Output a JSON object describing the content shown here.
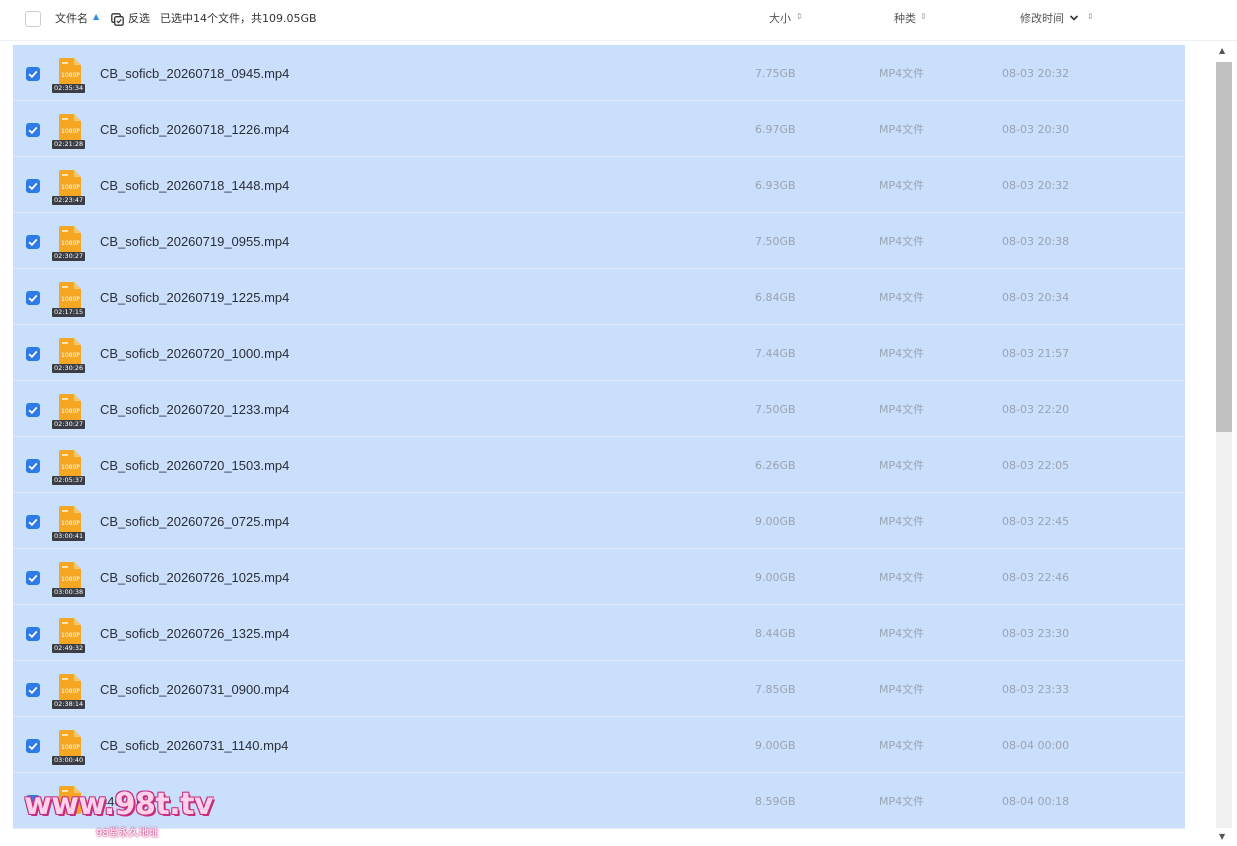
{
  "header": {
    "name_label": "文件名",
    "invert_label": "反选",
    "selection_summary": "已选中14个文件，共109.05GB",
    "size_label": "大小",
    "type_label": "种类",
    "time_label": "修改时间"
  },
  "colors": {
    "row_selected_bg": "#cadffc",
    "checkbox_checked": "#2e7be6",
    "file_icon": "#f5a623",
    "sort_active": "#2d8cf0"
  },
  "files": [
    {
      "name": "CB_soficb_20260718_0945.mp4",
      "size": "7.75GB",
      "type": "MP4文件",
      "modified": "08-03 20:32",
      "resolution": "1080P",
      "duration": "02:35:34",
      "checked": true
    },
    {
      "name": "CB_soficb_20260718_1226.mp4",
      "size": "6.97GB",
      "type": "MP4文件",
      "modified": "08-03 20:30",
      "resolution": "1080P",
      "duration": "02:21:28",
      "checked": true
    },
    {
      "name": "CB_soficb_20260718_1448.mp4",
      "size": "6.93GB",
      "type": "MP4文件",
      "modified": "08-03 20:32",
      "resolution": "1080P",
      "duration": "02:23:47",
      "checked": true
    },
    {
      "name": "CB_soficb_20260719_0955.mp4",
      "size": "7.50GB",
      "type": "MP4文件",
      "modified": "08-03 20:38",
      "resolution": "1080P",
      "duration": "02:30:27",
      "checked": true
    },
    {
      "name": "CB_soficb_20260719_1225.mp4",
      "size": "6.84GB",
      "type": "MP4文件",
      "modified": "08-03 20:34",
      "resolution": "1080P",
      "duration": "02:17:15",
      "checked": true
    },
    {
      "name": "CB_soficb_20260720_1000.mp4",
      "size": "7.44GB",
      "type": "MP4文件",
      "modified": "08-03 21:57",
      "resolution": "1080P",
      "duration": "02:30:26",
      "checked": true
    },
    {
      "name": "CB_soficb_20260720_1233.mp4",
      "size": "7.50GB",
      "type": "MP4文件",
      "modified": "08-03 22:20",
      "resolution": "1080P",
      "duration": "02:30:27",
      "checked": true
    },
    {
      "name": "CB_soficb_20260720_1503.mp4",
      "size": "6.26GB",
      "type": "MP4文件",
      "modified": "08-03 22:05",
      "resolution": "1080P",
      "duration": "02:05:37",
      "checked": true
    },
    {
      "name": "CB_soficb_20260726_0725.mp4",
      "size": "9.00GB",
      "type": "MP4文件",
      "modified": "08-03 22:45",
      "resolution": "1080P",
      "duration": "03:00:41",
      "checked": true
    },
    {
      "name": "CB_soficb_20260726_1025.mp4",
      "size": "9.00GB",
      "type": "MP4文件",
      "modified": "08-03 22:46",
      "resolution": "1080P",
      "duration": "03:00:38",
      "checked": true
    },
    {
      "name": "CB_soficb_20260726_1325.mp4",
      "size": "8.44GB",
      "type": "MP4文件",
      "modified": "08-03 23:30",
      "resolution": "1080P",
      "duration": "02:49:32",
      "checked": true
    },
    {
      "name": "CB_soficb_20260731_0900.mp4",
      "size": "7.85GB",
      "type": "MP4文件",
      "modified": "08-03 23:33",
      "resolution": "1080P",
      "duration": "02:38:14",
      "checked": true
    },
    {
      "name": "CB_soficb_20260731_1140.mp4",
      "size": "9.00GB",
      "type": "MP4文件",
      "modified": "08-04 00:00",
      "resolution": "1080P",
      "duration": "03:00:40",
      "checked": true
    },
    {
      "name": "440.mp4",
      "size": "8.59GB",
      "type": "MP4文件",
      "modified": "08-04 00:18",
      "resolution": "1080P",
      "duration": "",
      "checked": true
    }
  ],
  "watermark": {
    "text": "www.98t.tv",
    "subtext": "98堂永久地址"
  }
}
